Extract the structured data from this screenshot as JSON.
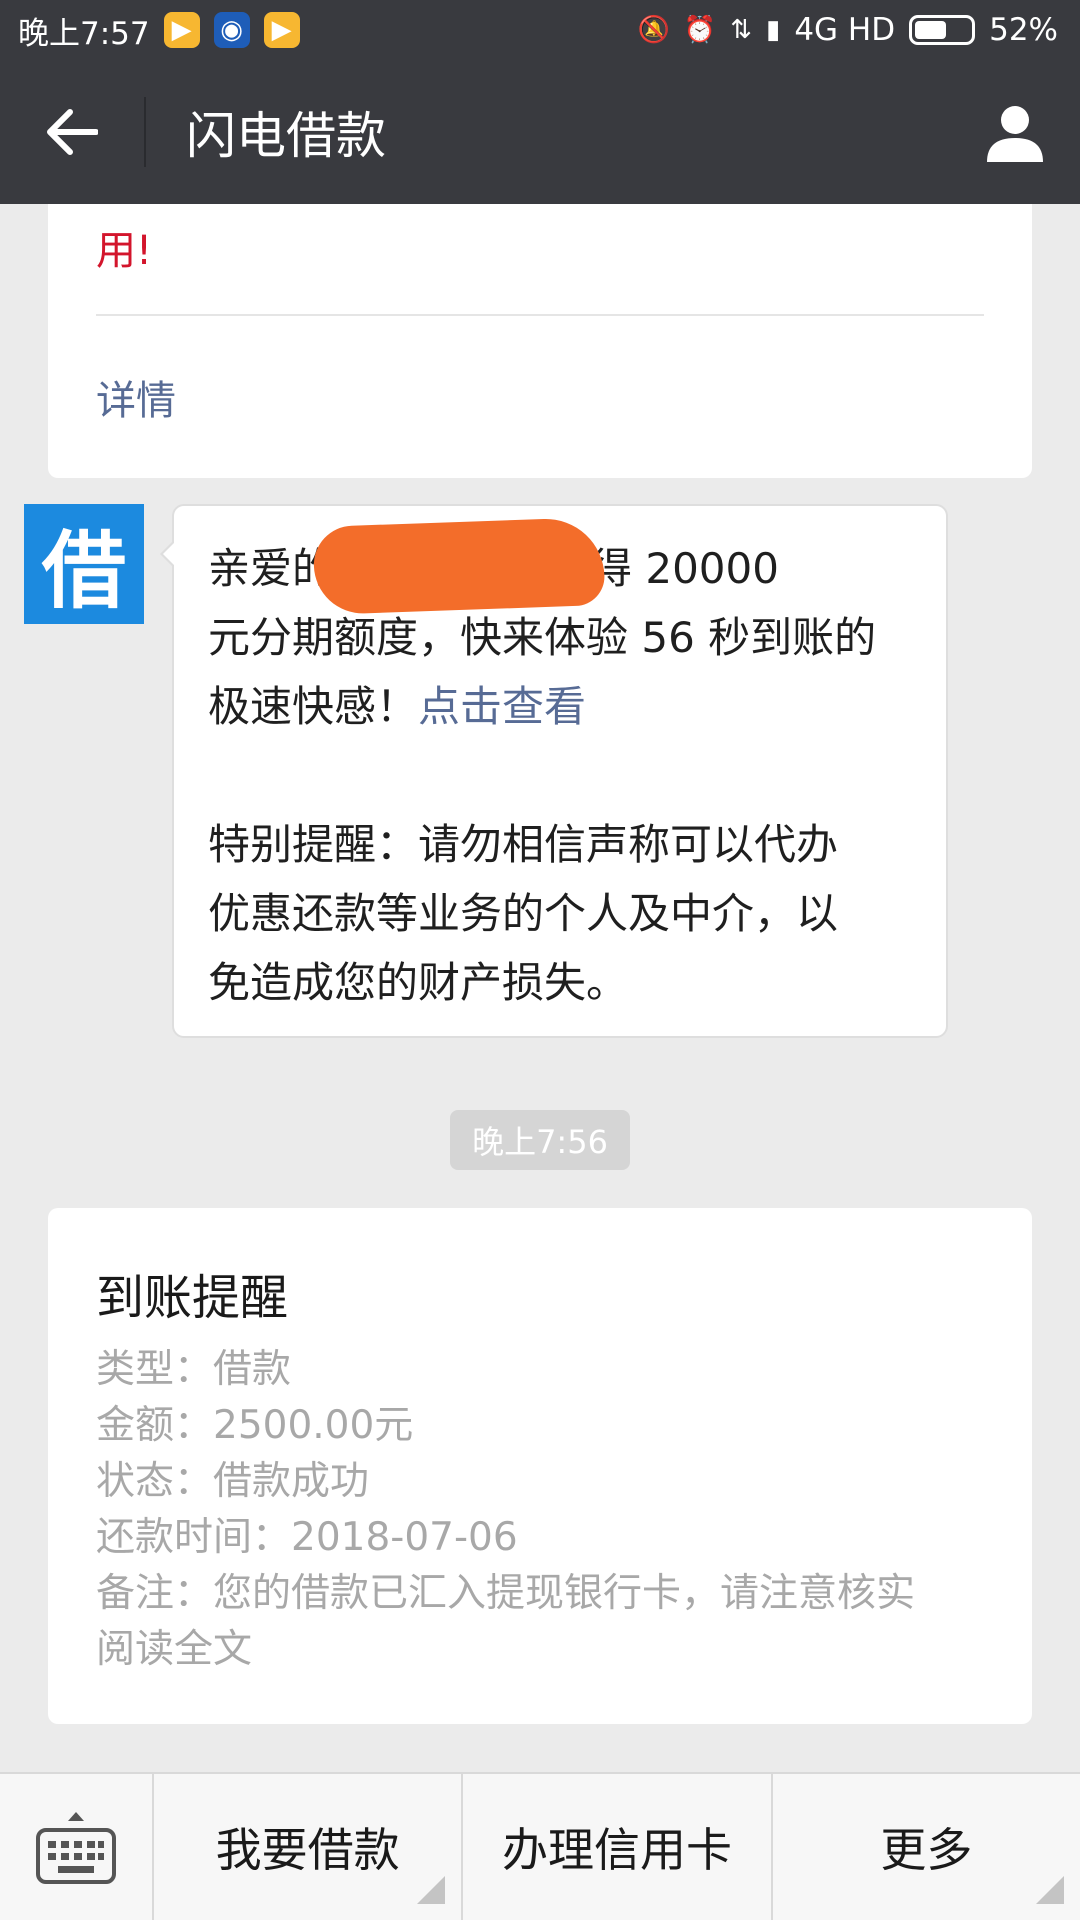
{
  "status_bar": {
    "time": "晚上7:57",
    "network": "4G HD",
    "battery": "52%"
  },
  "nav": {
    "title": "闪电借款"
  },
  "top_card": {
    "text": "用!",
    "details_link": "详情"
  },
  "avatar": {
    "char": "借"
  },
  "message": {
    "line1": "亲爱的",
    "line1_tail": "喜您获得 20000",
    "line2": "元分期额度，快来体验 56 秒到账的",
    "line3": "极速快感！",
    "link": "点击查看",
    "warning1": "特别提醒：请勿相信声称可以代办",
    "warning2": "优惠还款等业务的个人及中介，以",
    "warning3": "免造成您的财产损失。"
  },
  "timestamp": "晚上7:56",
  "notice": {
    "title": "到账提醒",
    "rows": [
      "类型：借款",
      "金额：2500.00元",
      "状态：借款成功",
      "还款时间：2018-07-06",
      "备注：您的借款已汇入提现银行卡，请注意核实",
      "阅读全文"
    ]
  },
  "menu": {
    "items": [
      "我要借款",
      "办理信用卡",
      "更多"
    ]
  },
  "colors": {
    "header_bg": "#393a3f",
    "link": "#576b95",
    "alert_red": "#d3152c",
    "avatar_blue": "#1c8adf"
  }
}
